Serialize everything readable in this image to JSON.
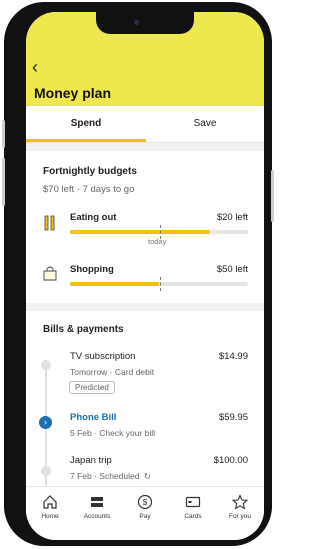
{
  "header": {
    "back_icon": "chevron-left-icon",
    "title": "Money plan"
  },
  "tabs": [
    {
      "label": "Spend",
      "active": true
    },
    {
      "label": "Save",
      "active": false
    }
  ],
  "budgets": {
    "title": "Fortnightly budgets",
    "summary": "$70 left · 7 days to go",
    "items": [
      {
        "label": "Eating out",
        "left": "$20 left",
        "progress": 0.78,
        "icon": "cutlery-icon",
        "marker_label": "today"
      },
      {
        "label": "Shopping",
        "left": "$50 left",
        "progress": 0.5,
        "icon": "shopping-bag-icon"
      }
    ]
  },
  "bills": {
    "title": "Bills & payments",
    "items": [
      {
        "name": "TV subscription",
        "detail": "Tomorrow · Card debit",
        "amount": "$14.99",
        "tag": "Predicted"
      },
      {
        "name": "Phone Bill",
        "detail": "5 Feb · Check your bill",
        "amount": "$59.95",
        "active": true
      },
      {
        "name": "Japan trip",
        "detail": "7 Feb · Scheduled",
        "amount": "$100.00",
        "icon": "repeat-icon"
      }
    ]
  },
  "nav": [
    {
      "label": "Home",
      "icon": "home-icon"
    },
    {
      "label": "Accounts",
      "icon": "accounts-icon"
    },
    {
      "label": "Pay",
      "icon": "pay-icon"
    },
    {
      "label": "Cards",
      "icon": "card-icon"
    },
    {
      "label": "For you",
      "icon": "star-icon"
    }
  ],
  "colors": {
    "brand_yellow": "#ede84e",
    "progress": "#f3c00f",
    "link_blue": "#1a6fb5"
  }
}
